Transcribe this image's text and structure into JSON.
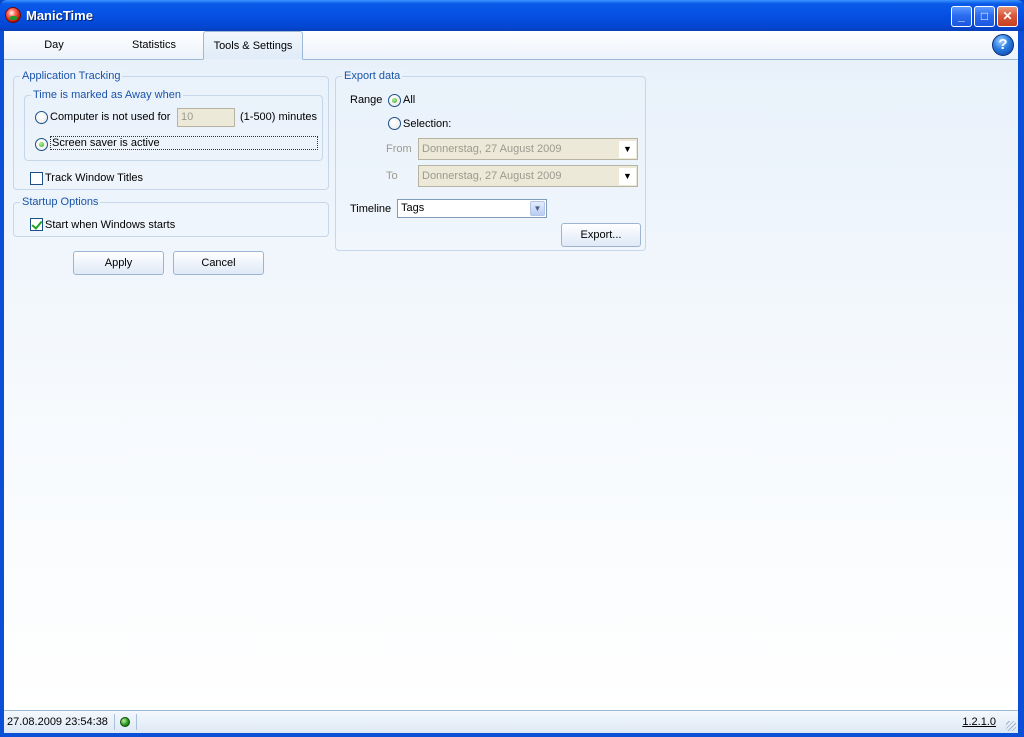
{
  "window": {
    "title": "ManicTime"
  },
  "tabs": [
    {
      "label": "Day"
    },
    {
      "label": "Statistics"
    },
    {
      "label": "Tools & Settings"
    }
  ],
  "app_tracking": {
    "title": "Application Tracking",
    "away": {
      "title": "Time is marked as Away when",
      "option1_label": "Computer is not used for",
      "minutes_value": "10",
      "range_hint": "(1-500) minutes",
      "option2_label": "Screen saver is active",
      "selected": "screen_saver"
    },
    "track_titles_label": "Track Window Titles",
    "track_titles_checked": false
  },
  "startup": {
    "title": "Startup Options",
    "start_label": "Start when Windows starts",
    "start_checked": true
  },
  "buttons": {
    "apply": "Apply",
    "cancel": "Cancel",
    "export": "Export..."
  },
  "export": {
    "title": "Export data",
    "range_label": "Range",
    "all_label": "All",
    "selection_label": "Selection:",
    "selected": "all",
    "from_label": "From",
    "from_value": "Donnerstag, 27 August 2009",
    "to_label": "To",
    "to_value": "Donnerstag, 27 August 2009",
    "timeline_label": "Timeline",
    "timeline_value": "Tags"
  },
  "status": {
    "datetime": "27.08.2009 23:54:38",
    "version": "1.2.1.0",
    "indicator_color": "#2a9a1e"
  }
}
